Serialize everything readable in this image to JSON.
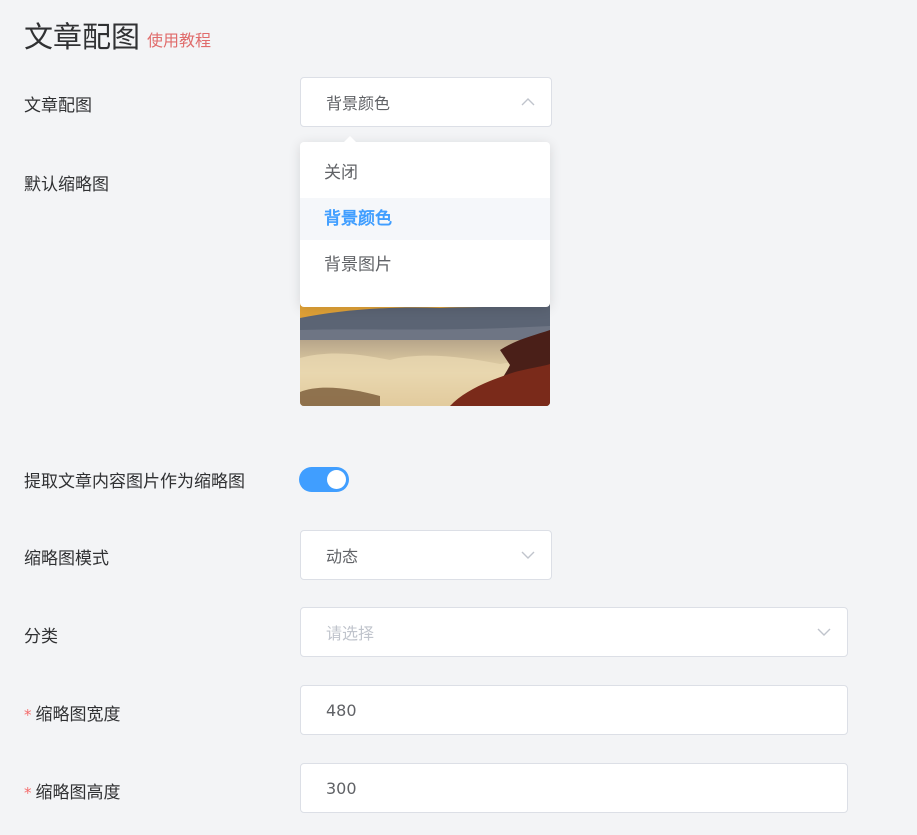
{
  "header": {
    "title": "文章配图",
    "tutorial_link": "使用教程"
  },
  "form": {
    "article_image": {
      "label": "文章配图",
      "value": "背景颜色",
      "expanded": true,
      "options": [
        "关闭",
        "背景颜色",
        "背景图片"
      ],
      "selected_index": 1
    },
    "default_thumb": {
      "label": "默认缩略图"
    },
    "extract_from_content": {
      "label": "提取文章内容图片作为缩略图",
      "enabled": true
    },
    "thumb_mode": {
      "label": "缩略图模式",
      "value": "动态"
    },
    "category": {
      "label": "分类",
      "placeholder": "请选择"
    },
    "thumb_width": {
      "required_mark": "*",
      "label": "缩略图宽度",
      "value": "480"
    },
    "thumb_height": {
      "required_mark": "*",
      "label": "缩略图高度",
      "value": "300"
    }
  },
  "colors": {
    "accent": "#409eff",
    "link": "#e06c6c",
    "required": "#f56c6c"
  }
}
